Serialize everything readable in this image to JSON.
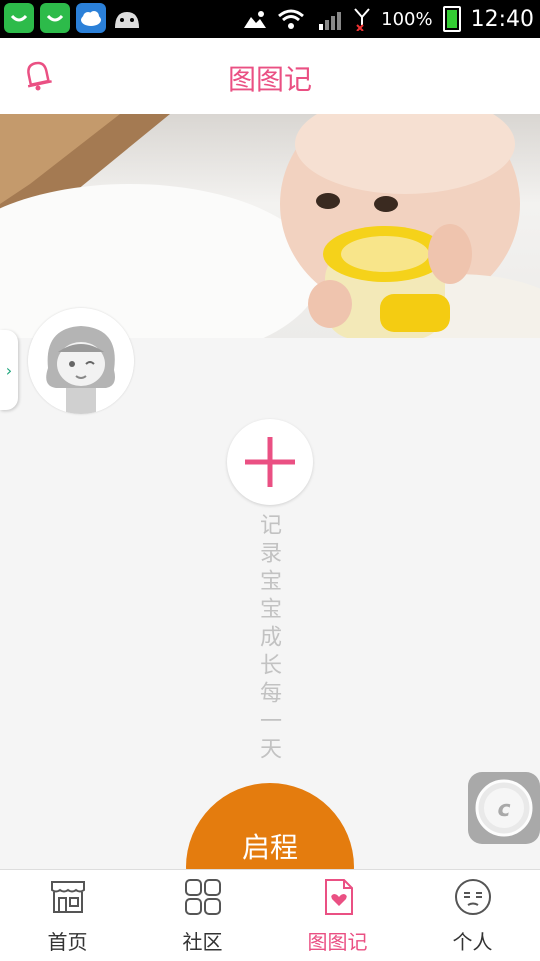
{
  "status_bar": {
    "battery": "100%",
    "time": "12:40"
  },
  "header": {
    "title": "图图记"
  },
  "main": {
    "prompt_text": "记录宝宝成长每一天",
    "start_button_label": "启程"
  },
  "tabbar": {
    "tabs": [
      {
        "label": "首页",
        "icon": "storefront-icon"
      },
      {
        "label": "社区",
        "icon": "grid-icon"
      },
      {
        "label": "图图记",
        "icon": "diary-heart-icon"
      },
      {
        "label": "个人",
        "icon": "face-icon"
      }
    ]
  },
  "colors": {
    "accent": "#ea5083",
    "start_button": "#e47c0e",
    "nav_arrow": "#1aa37a"
  }
}
